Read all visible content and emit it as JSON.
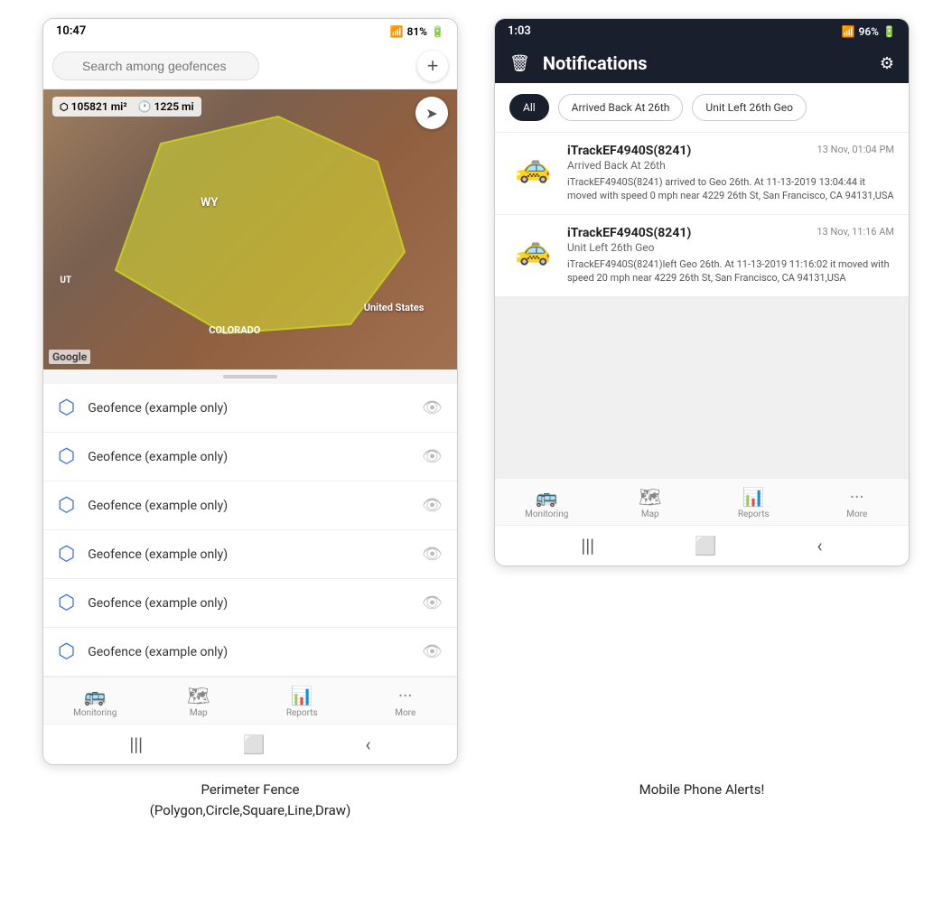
{
  "left_phone": {
    "status_time": "10:47",
    "status_wifi": "📶",
    "status_battery": "81%",
    "search_placeholder": "Search among geofences",
    "map_stat1": "105821 mi²",
    "map_stat2": "1225 mi",
    "map_labels": {
      "wy": "WY",
      "us": "United States",
      "ut": "UT",
      "colorado": "COLORADO"
    },
    "geofences": [
      "Geofence (example only)",
      "Geofence (example only)",
      "Geofence (example only)",
      "Geofence (example only)",
      "Geofence (example only)",
      "Geofence (example only)"
    ],
    "nav_items": [
      {
        "label": "Monitoring",
        "icon": "🚌"
      },
      {
        "label": "Map",
        "icon": "🗺"
      },
      {
        "label": "Reports",
        "icon": "📊"
      },
      {
        "label": "More",
        "icon": "···"
      }
    ]
  },
  "right_phone": {
    "status_time": "1:03",
    "status_battery": "96%",
    "header_title": "Notifications",
    "filter_tabs": [
      {
        "label": "All",
        "active": true
      },
      {
        "label": "Arrived Back At 26th",
        "active": false
      },
      {
        "label": "Unit Left 26th Geo",
        "active": false
      }
    ],
    "notifications": [
      {
        "device": "iTrackEF4940S(8241)",
        "time": "13 Nov, 01:04 PM",
        "subtitle": "Arrived Back At 26th",
        "body": "iTrackEF4940S(8241) arrived to Geo 26th.    At 11-13-2019 13:04:44 it moved with speed 0 mph near 4229 26th St, San Francisco, CA 94131,USA"
      },
      {
        "device": "iTrackEF4940S(8241)",
        "time": "13 Nov, 11:16 AM",
        "subtitle": "Unit Left 26th Geo",
        "body": "iTrackEF4940S(8241)left Geo 26th.    At 11-13-2019 11:16:02 it moved with speed 20 mph near 4229 26th St, San Francisco, CA 94131,USA"
      }
    ],
    "nav_items": [
      {
        "label": "Monitoring",
        "icon": "🚌"
      },
      {
        "label": "Map",
        "icon": "🗺"
      },
      {
        "label": "Reports",
        "icon": "📊"
      },
      {
        "label": "More",
        "icon": "···"
      }
    ]
  },
  "captions": {
    "left": "Perimeter Fence\n(Polygon,Circle,Square,Line,Draw)",
    "right": "Mobile Phone Alerts!"
  }
}
